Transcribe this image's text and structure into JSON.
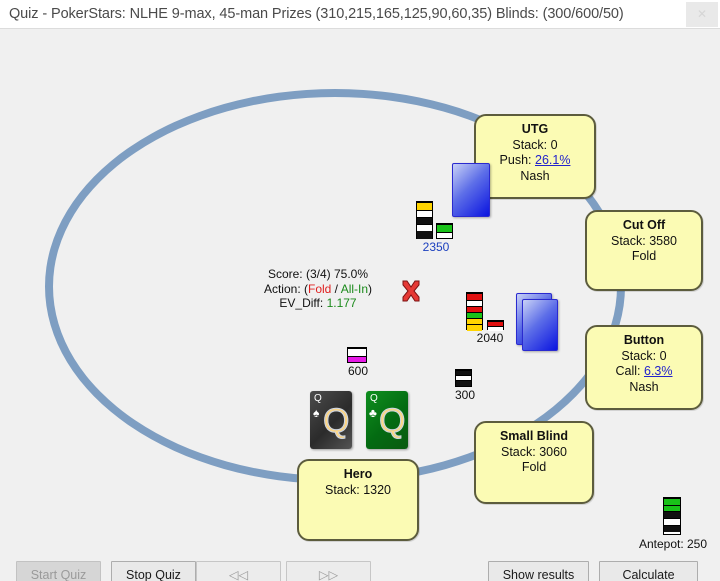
{
  "window": {
    "title": "Quiz - PokerStars: NLHE 9-max, 45-man Prizes (310,215,165,125,90,60,35) Blinds: (300/600/50)",
    "close_label": "✕"
  },
  "seats": [
    {
      "id": "utg",
      "name": "UTG",
      "stack": "Stack: 0",
      "action_label": "Push:",
      "action_pct": "26.1%",
      "source": "Nash"
    },
    {
      "id": "cutoff",
      "name": "Cut Off",
      "stack": "Stack: 3580",
      "action_label": "Fold",
      "action_pct": "",
      "source": ""
    },
    {
      "id": "button",
      "name": "Button",
      "stack": "Stack: 0",
      "action_label": "Call:",
      "action_pct": "6.3%",
      "source": "Nash"
    },
    {
      "id": "smallblind",
      "name": "Small Blind",
      "stack": "Stack: 3060",
      "action_label": "Fold",
      "action_pct": "",
      "source": ""
    },
    {
      "id": "hero",
      "name": "Hero",
      "stack": "Stack: 1320",
      "action_label": "",
      "action_pct": "",
      "source": ""
    }
  ],
  "center": {
    "score_label": "Score:",
    "score_value": "(3/4) 75.0%",
    "action_label": "Action:",
    "action_open": "(",
    "action_chosen": "Fold",
    "action_divider": " / ",
    "action_correct": "All-In",
    "action_close": ")",
    "evdiff_label": "EV_Diff:",
    "evdiff_value": "1.177",
    "result_icon": "cross-mark-icon"
  },
  "bets": [
    {
      "id": "utg-bet",
      "amount": "2350"
    },
    {
      "id": "pot",
      "amount": "2040"
    },
    {
      "id": "bb-bet",
      "amount": "600"
    },
    {
      "id": "sb-bet",
      "amount": "300"
    }
  ],
  "hero_cards": [
    {
      "rank": "Q",
      "suit_glyph": "♠",
      "suit_name": "spades",
      "style": "spade"
    },
    {
      "rank": "Q",
      "suit_glyph": "♣",
      "suit_name": "clubs",
      "style": "club"
    }
  ],
  "antepot": {
    "label": "Antepot: 250"
  },
  "toolbar": {
    "start_label": "Start Quiz",
    "stop_label": "Stop Quiz",
    "prev_label": "◁◁",
    "next_label": "▷▷",
    "show_results_label": "Show results",
    "calculate_label": "Calculate"
  },
  "colors": {
    "table_felt_edge": "#7e9ec2",
    "seat_fill": "#fbfbb4",
    "seat_border": "#5c5c3d",
    "link": "#2222cc",
    "fold": "#e02020",
    "allin": "#1a8a1a",
    "background": "#f0f0f0"
  }
}
